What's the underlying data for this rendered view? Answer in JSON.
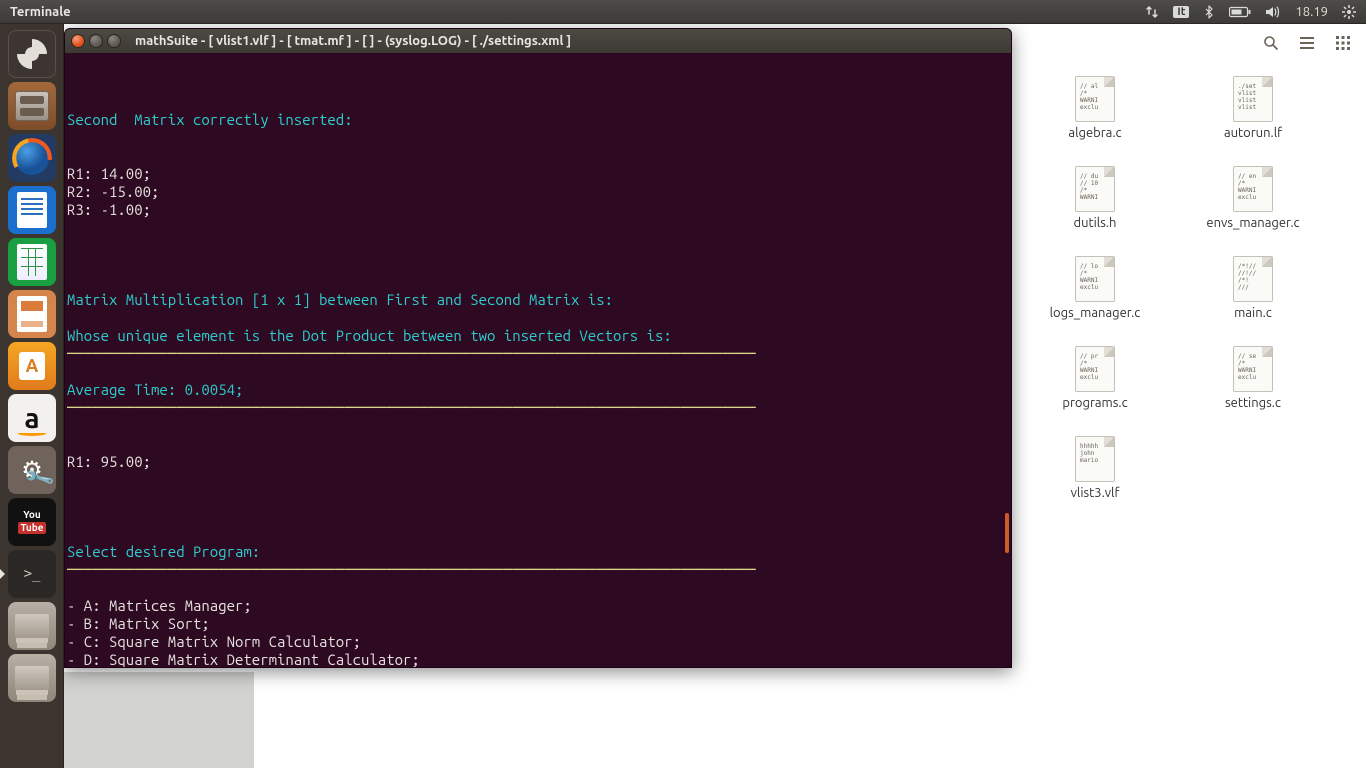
{
  "panel": {
    "menu_label": "Terminale",
    "lang": "It",
    "time": "18.19"
  },
  "launcher": {
    "tiles": [
      {
        "name": "dash-icon"
      },
      {
        "name": "files-icon"
      },
      {
        "name": "firefox-icon"
      },
      {
        "name": "writer-icon"
      },
      {
        "name": "calc-icon"
      },
      {
        "name": "impress-icon"
      },
      {
        "name": "software-icon"
      },
      {
        "name": "amazon-icon"
      },
      {
        "name": "settings-icon"
      },
      {
        "name": "youtube-icon"
      },
      {
        "name": "terminal-icon"
      },
      {
        "name": "device1-icon"
      },
      {
        "name": "device2-icon"
      }
    ],
    "youtube_top": "You",
    "youtube_bottom": "Tube",
    "terminal_prompt": ">_"
  },
  "files": {
    "items": [
      {
        "label": "algebra.c",
        "preview": "// al\n/*\nWARNI\nexclu"
      },
      {
        "label": "autorun.lf",
        "preview": "./set\nvlist\nvlist\nvlist"
      },
      {
        "label": "dutils.h",
        "preview": "// du\n// 10\n/*\nWARNI"
      },
      {
        "label": "envs_manager.c",
        "preview": "// en\n/*\nWARNI\nexclu"
      },
      {
        "label": "logs_manager.c",
        "preview": "// lo\n/*\nWARNI\nexclu"
      },
      {
        "label": "main.c",
        "preview": "/*!//\n//!//\n/*!\n///"
      },
      {
        "label": "programs.c",
        "preview": "// pr\n/*\nWARNI\nexclu"
      },
      {
        "label": "settings.c",
        "preview": "// se\n/*\nWARNI\nexclu"
      },
      {
        "label": "vlist3.vlf",
        "preview": "hhhhh\njohn\nmario\n"
      }
    ]
  },
  "terminal": {
    "title": "mathSuite - [ vlist1.vlf ] - [ tmat.mf ] - [  ] - (syslog.LOG) - [ ./settings.xml ]",
    "hr": "──────────────────────────────────────────────────────────────────────────────────",
    "lines": {
      "l1": "Second  Matrix correctly inserted:",
      "r1": "R1: 14.00;",
      "r2": "R2: -15.00;",
      "r3": "R3: -1.00;",
      "mm": "Matrix Multiplication [1 x 1] between First and Second Matrix is:",
      "dp": "Whose unique element is the Dot Product between two inserted Vectors is:",
      "avg": "Average Time: 0.0054;",
      "res": "R1: 95.00;",
      "sel": "Select desired Program:",
      "pA": "- A: Matrices Manager;",
      "pB": "- B: Matrix Sort;",
      "pC": "- C: Square Matrix Norm Calculator;",
      "pD": "- D: Square Matrix Determinant Calculator;"
    }
  }
}
